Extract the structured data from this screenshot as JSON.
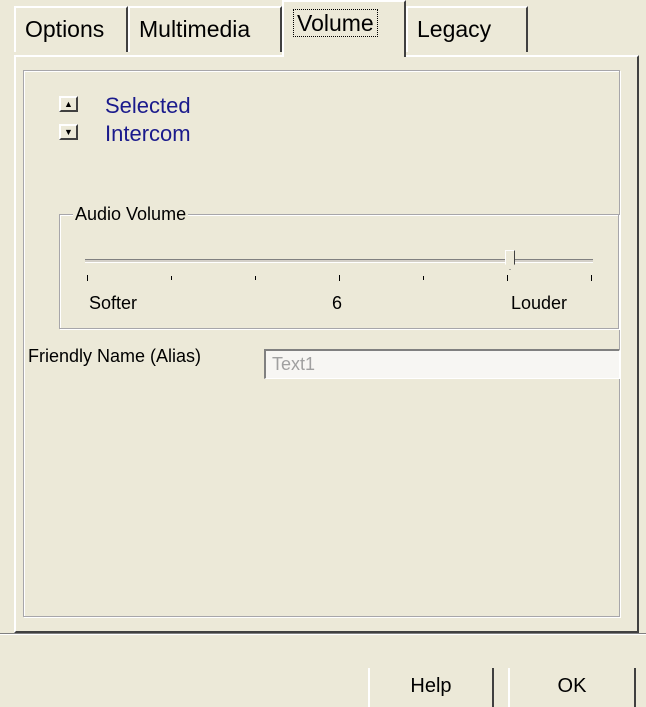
{
  "tabs": [
    {
      "label": "Options",
      "active": false
    },
    {
      "label": "Multimedia",
      "active": false
    },
    {
      "label": "Volume",
      "active": true
    },
    {
      "label": "Legacy",
      "active": false
    }
  ],
  "selector": {
    "items": [
      "Selected",
      "Intercom"
    ],
    "color": "#1a1a8c"
  },
  "audio_volume": {
    "title": "Audio Volume",
    "min_label": "Softer",
    "mid_label": "6",
    "max_label": "Louder",
    "value_fraction": 0.84
  },
  "friendly_name": {
    "label": "Friendly Name (Alias)",
    "value": "Text1"
  },
  "buttons": {
    "help": "Help",
    "ok": "OK"
  }
}
